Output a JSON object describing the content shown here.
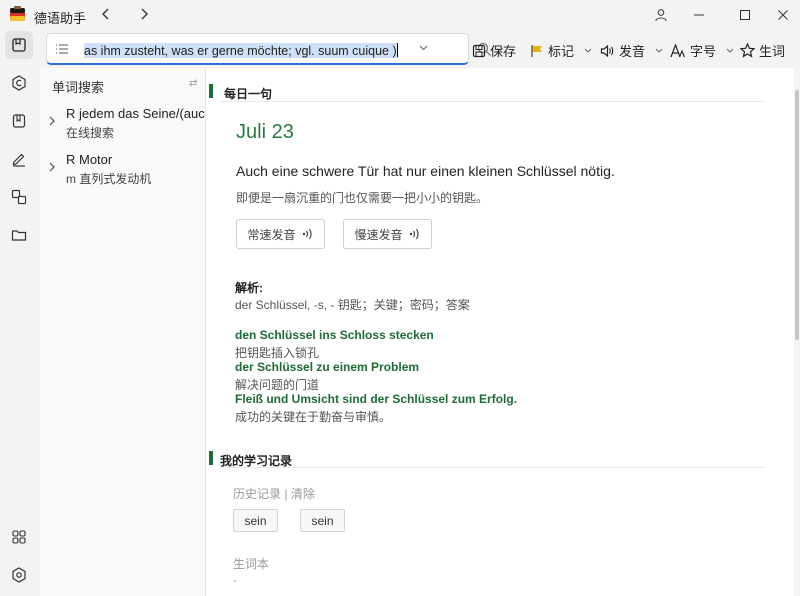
{
  "window": {
    "title": "德语助手",
    "nav_back": "‹",
    "nav_forward": "›"
  },
  "toolbar": {
    "search_value": "as ihm zusteht, was er gerne möchte; vgl. suum cuique )",
    "save_label": "保存",
    "mark_label": "标记",
    "pronounce_label": "发音",
    "font_label": "字号",
    "vocab_label": "生词",
    "mark_color": "#e0b020"
  },
  "sidebar": {
    "title": "单词搜索",
    "sort_glyph": "⇄",
    "entries": [
      {
        "word": "R jedem das Seine/(auc",
        "sub": "在线搜索"
      },
      {
        "word": "R Motor",
        "sub": "m 直列式发动机"
      }
    ]
  },
  "daily": {
    "section_title": "每日一句",
    "date": "Juli 23",
    "sentence_de": "Auch eine schwere Tür hat nur einen kleinen Schlüssel nötig.",
    "sentence_zh": "即便是一扇沉重的门也仅需要一把小小的钥匙。",
    "normal_speed": "常速发音",
    "slow_speed": "慢速发音",
    "analysis_label": "解析:",
    "analysis_text": "der Schlüssel, -s, - 钥匙；关键；密码；答案",
    "examples": [
      {
        "de": "den Schlüssel ins Schloss stecken",
        "zh": "把钥匙插入锁孔"
      },
      {
        "de": "der Schlüssel zu einem Problem",
        "zh": "解决问题的门道"
      },
      {
        "de": "Fleiß und Umsicht sind der Schlüssel zum Erfolg.",
        "zh": "成功的关键在于勤奋与审慎。"
      }
    ],
    "accent_color": "#1e6b36"
  },
  "records": {
    "section_title": "我的学习记录",
    "history_label": "历史记录",
    "separator": "|",
    "clear_label": "清除",
    "history_items": [
      "sein",
      "sein"
    ],
    "vocab_heading": "生词本",
    "vocab_empty": "-"
  }
}
